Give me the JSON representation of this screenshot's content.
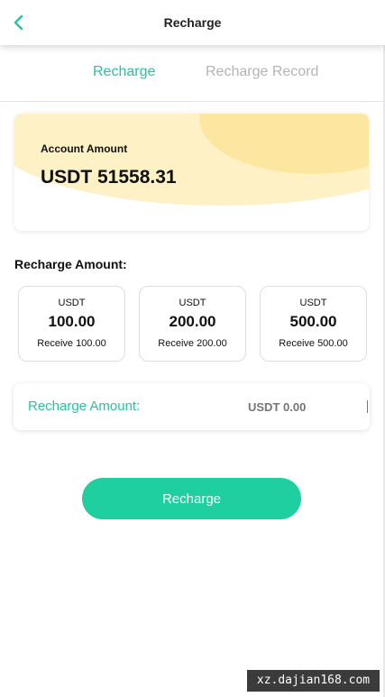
{
  "header": {
    "title": "Recharge",
    "back_icon": "chevron-left-icon"
  },
  "tabs": [
    {
      "label": "Recharge",
      "active": true
    },
    {
      "label": "Recharge Record",
      "active": false
    }
  ],
  "account": {
    "label": "Account Amount",
    "value": "USDT 51558.31"
  },
  "amount_section": {
    "label": "Recharge Amount:"
  },
  "options": [
    {
      "currency": "USDT",
      "amount": "100.00",
      "receive": "Receive 100.00"
    },
    {
      "currency": "USDT",
      "amount": "200.00",
      "receive": "Receive 200.00"
    },
    {
      "currency": "USDT",
      "amount": "500.00",
      "receive": "Receive 500.00"
    }
  ],
  "input": {
    "label": "Recharge Amount:",
    "placeholder": "USDT 0.00",
    "value": ""
  },
  "submit": {
    "label": "Recharge"
  },
  "watermark": {
    "text": "xz.dajian168.com"
  },
  "colors": {
    "accent": "#28c3a0",
    "button": "#1fcf9f",
    "card_wave": "#fde7a0"
  }
}
